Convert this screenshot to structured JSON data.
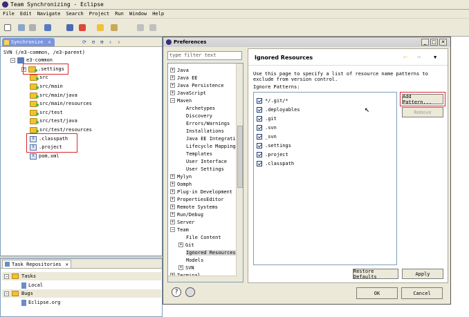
{
  "window": {
    "title": "Team Synchronizing - Eclipse"
  },
  "menu": [
    "File",
    "Edit",
    "Navigate",
    "Search",
    "Project",
    "Run",
    "Window",
    "Help"
  ],
  "sync_view": {
    "tab_label": "Synchronize",
    "path": "SVN (/e3-common, /e3-parent)",
    "root": "e3-common",
    "items": [
      ".settings",
      "src",
      "src/main",
      "src/main/java",
      "src/main/resources",
      "src/test",
      "src/test/java",
      "src/test/resources",
      ".classpath",
      ".project",
      "pom.xml"
    ]
  },
  "repo_view": {
    "tab_label": "Task Repositories",
    "categories": [
      {
        "name": "Tasks",
        "item": "Local"
      },
      {
        "name": "Bugs",
        "item": "Eclipse.org"
      }
    ]
  },
  "dialog": {
    "title": "Preferences",
    "filter_placeholder": "type filter text",
    "nav": {
      "java": "Java",
      "javaee": "Java EE",
      "javapersist": "Java Persistence",
      "javascript": "JavaScript",
      "maven": "Maven",
      "archetypes": "Archetypes",
      "discovery": "Discovery",
      "errors": "Errors/Warnings",
      "installations": "Installations",
      "javaee_int": "Java EE Integratio",
      "lifecycle": "Lifecycle Mappings",
      "templates": "Templates",
      "userint": "User Interface",
      "usersettings": "User Settings",
      "mylyn": "Mylyn",
      "oomph": "Oomph",
      "plugin": "Plug-in Development",
      "properties": "PropertiesEditor",
      "remote": "Remote Systems",
      "rundebug": "Run/Debug",
      "server": "Server",
      "team": "Team",
      "filecontent": "File Content",
      "git": "Git",
      "ignored": "Ignored Resources",
      "models": "Models",
      "svn": "SVN",
      "terminal": "Terminal"
    },
    "page": {
      "title": "Ignored Resources",
      "description": "Use this page to specify a list of resource name patterns to exclude from version control.",
      "patterns_label": "Ignore Patterns:",
      "patterns": [
        "*/.git/*",
        ".deployables",
        ".git",
        ".svn",
        "_svn",
        ".settings",
        ".project",
        ".classpath"
      ],
      "add_button": "Add Pattern...",
      "remove_button": "Remove",
      "restore_button": "Restore Defaults",
      "apply_button": "Apply"
    },
    "ok_button": "OK",
    "cancel_button": "Cancel"
  }
}
